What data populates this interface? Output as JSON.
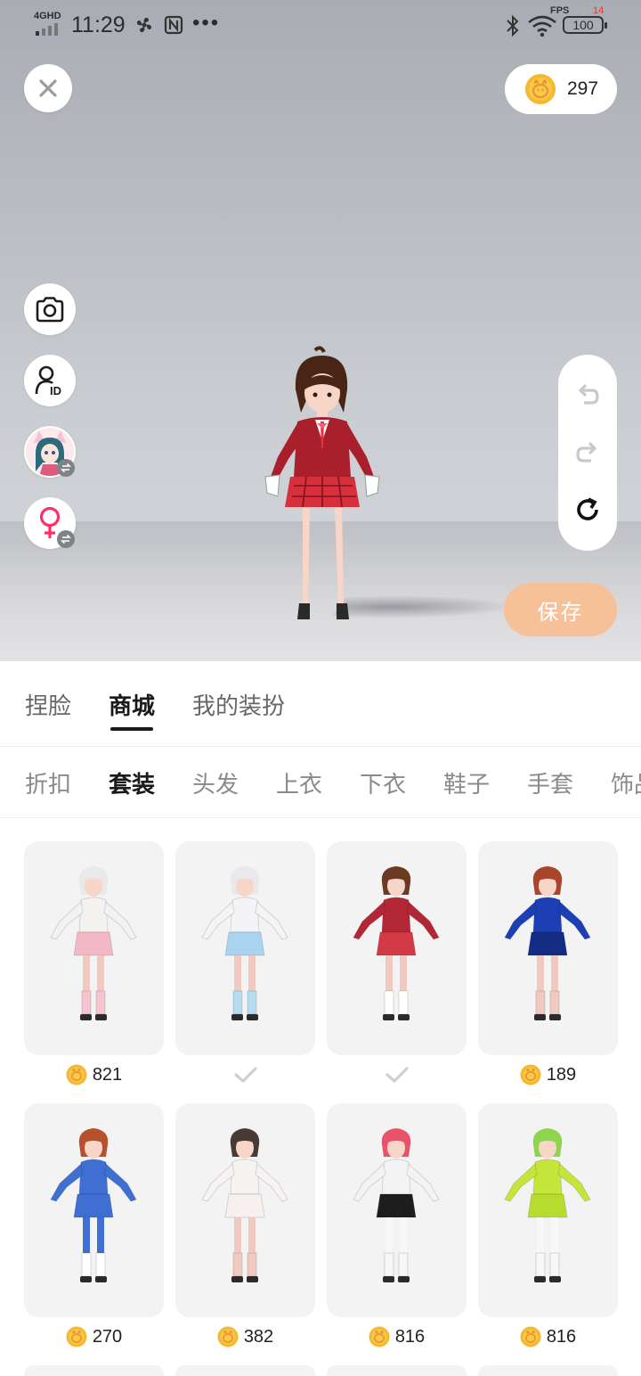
{
  "status_bar": {
    "signal": "4GHD",
    "time": "11:29",
    "fps_label": "FPS",
    "fps_value": "14",
    "battery": "100"
  },
  "header": {
    "coins": "297"
  },
  "save_label": "保存",
  "main_tabs": [
    {
      "label": "捏脸",
      "active": false
    },
    {
      "label": "商城",
      "active": true
    },
    {
      "label": "我的装扮",
      "active": false
    }
  ],
  "sub_tabs": [
    {
      "label": "折扣",
      "active": false
    },
    {
      "label": "套装",
      "active": true
    },
    {
      "label": "头发",
      "active": false
    },
    {
      "label": "上衣",
      "active": false
    },
    {
      "label": "下衣",
      "active": false
    },
    {
      "label": "鞋子",
      "active": false
    },
    {
      "label": "手套",
      "active": false
    },
    {
      "label": "饰品",
      "active": false
    }
  ],
  "outfits": [
    {
      "price": "821",
      "owned": false,
      "hair": "#e9e9ec",
      "top": "#f4f1f1",
      "skirt": "#f2b8c6",
      "legs": "#f0c9c0",
      "socks": "#f5c4cf"
    },
    {
      "price": "",
      "owned": true,
      "hair": "#e9e9ec",
      "top": "#f4f4f7",
      "skirt": "#a9d3ef",
      "legs": "#f0c9c0",
      "socks": "#b7dbef"
    },
    {
      "price": "",
      "owned": true,
      "hair": "#6b3a22",
      "top": "#b32635",
      "skirt": "#d23a45",
      "legs": "#f0c9c0",
      "socks": "#ffffff"
    },
    {
      "price": "189",
      "owned": false,
      "hair": "#a8452a",
      "top": "#1d3fb5",
      "skirt": "#142c84",
      "legs": "#f0c9c0",
      "socks": "#f0c9c0"
    },
    {
      "price": "270",
      "owned": false,
      "hair": "#b7502c",
      "top": "#3f6fd2",
      "skirt": "#3f6fd2",
      "legs": "#3f6fd2",
      "socks": "#ffffff"
    },
    {
      "price": "382",
      "owned": false,
      "hair": "#4a3a36",
      "top": "#f7f3f2",
      "skirt": "#f7f0ee",
      "legs": "#f0c9c0",
      "socks": "#f0c9c0"
    },
    {
      "price": "816",
      "owned": false,
      "hair": "#e8536b",
      "top": "#f3f3f3",
      "skirt": "#1d1d1d",
      "legs": "#f7f7f7",
      "socks": "#f7f7f7"
    },
    {
      "price": "816",
      "owned": false,
      "hair": "#8fd44e",
      "top": "#c4e53a",
      "skirt": "#b6dd2e",
      "legs": "#f7f7f7",
      "socks": "#f7f7f7"
    }
  ],
  "colors": {
    "accent_save": "#f6c098",
    "coin": "#f5b82e",
    "active_text": "#1a1a1a",
    "inactive_text": "#8a8a8a",
    "gender_icon": "#ff2e63"
  },
  "icons": [
    "close-icon",
    "coin-icon",
    "camera-icon",
    "profile-id-icon",
    "avatar-switch-icon",
    "female-gender-icon",
    "undo-icon",
    "redo-icon",
    "reset-icon",
    "checkmark-icon"
  ]
}
